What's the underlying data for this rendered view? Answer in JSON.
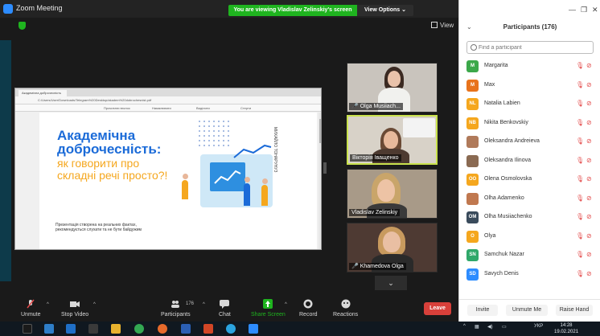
{
  "window": {
    "title": "Zoom Meeting"
  },
  "share_banner": "You are viewing Vladislav Zelinskiy's screen",
  "view_options": "View Options",
  "view_button": "View",
  "shared_screen": {
    "tab_title": "Академічна доброчесність",
    "url": "C:/Users/User/Downloads/Telegram%20Desktop/akadem%20dobrochesnist.pdf",
    "pdf_toolbar": [
      "Прочитати вголос",
      "Намалювати",
      "Виділити",
      "Стерти"
    ],
    "slide_title": "Академічна доброчесність:",
    "slide_subtitle": "як говорити про складні речі просто?!",
    "slide_note": "Презентація створена на реальних фактах, рекомендується слухати та не бути байдужим",
    "slide_side": "МИХАЙЛО ТОНАРУНУЗ"
  },
  "video_tiles": [
    {
      "name": "Olga Musiiach...",
      "muted": true
    },
    {
      "name": "Вікторія Іващенко",
      "muted": false,
      "active": true
    },
    {
      "name": "Vladislav Zelinskiy",
      "muted": false
    },
    {
      "name": "Khamedova Olga",
      "muted": true
    }
  ],
  "toolbar": {
    "unmute": "Unmute",
    "stop_video": "Stop Video",
    "participants": "Participants",
    "participants_count": "176",
    "chat": "Chat",
    "share_screen": "Share Screen",
    "record": "Record",
    "reactions": "Reactions",
    "leave": "Leave"
  },
  "panel": {
    "title": "Participants (176)",
    "search_placeholder": "Find a participant",
    "participants": [
      {
        "initials": "M",
        "name": "Margarita",
        "color": "#3ca84a"
      },
      {
        "initials": "M",
        "name": "Max",
        "color": "#e8731c"
      },
      {
        "initials": "NL",
        "name": "Natalia Labien",
        "color": "#f5a71e"
      },
      {
        "initials": "NB",
        "name": "Nikita Benkovskiy",
        "color": "#f5a71e"
      },
      {
        "initials": "",
        "name": "Oleksandra Andreieva",
        "color": "#b07a5a"
      },
      {
        "initials": "",
        "name": "Oleksandra Ilinova",
        "color": "#8a6a52"
      },
      {
        "initials": "OO",
        "name": "Olena Osmolovska",
        "color": "#f5a71e"
      },
      {
        "initials": "",
        "name": "Olha Adamenko",
        "color": "#c0784f"
      },
      {
        "initials": "OM",
        "name": "Olha Musiiachenko",
        "color": "#3a4b5c"
      },
      {
        "initials": "O",
        "name": "Olya",
        "color": "#f5a71e"
      },
      {
        "initials": "SN",
        "name": "Samchuk Nazar",
        "color": "#2fa86a"
      },
      {
        "initials": "SD",
        "name": "Savych Denis",
        "color": "#2d8cff"
      }
    ],
    "invite": "Invite",
    "unmute_me": "Unmute Me",
    "raise_hand": "Raise Hand"
  },
  "taskbar": {
    "lang": "УКР",
    "time": "14:28",
    "date": "19.02.2021"
  }
}
